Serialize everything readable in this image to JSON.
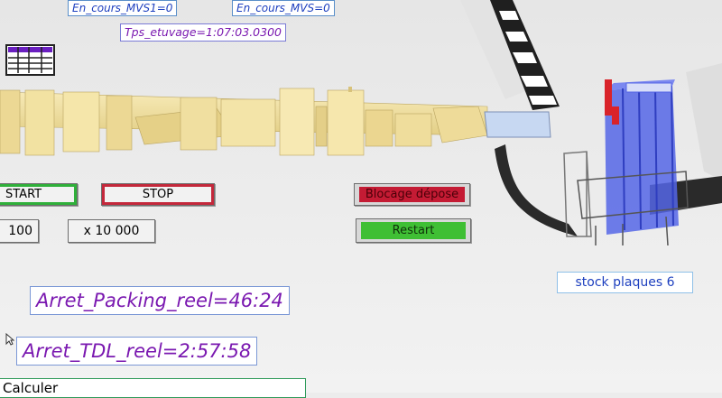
{
  "status_labels": {
    "en_cours_mvs1": "En_cours_MVS1=0",
    "en_cours_mvs": "En_cours_MVS=0",
    "tps_etuvage": "Tps_etuvage=1:07:03.0300"
  },
  "controls": {
    "start_label": "START",
    "stop_label": "STOP",
    "speed_value": "100",
    "multiplier_label": "x 10 000",
    "blocage_label": "Blocage dépose",
    "restart_label": "Restart",
    "calculer_label": "Calculer"
  },
  "readouts": {
    "arret_packing": "Arret_Packing_reel=46:24",
    "arret_tdl": "Arret_TDL_reel=2:57:58",
    "stock_plaques": "stock plaques 6"
  },
  "colors": {
    "start_border": "#2fb03a",
    "stop_border": "#c4283b",
    "blocage_fill": "#c41b34",
    "restart_fill": "#3fbf34",
    "machine_yellow": "#f2e2a2",
    "stack_blue": "#5566e6"
  },
  "icons": {
    "table_icon": "spreadsheet-table-icon",
    "cursor": "mouse-pointer-icon"
  }
}
